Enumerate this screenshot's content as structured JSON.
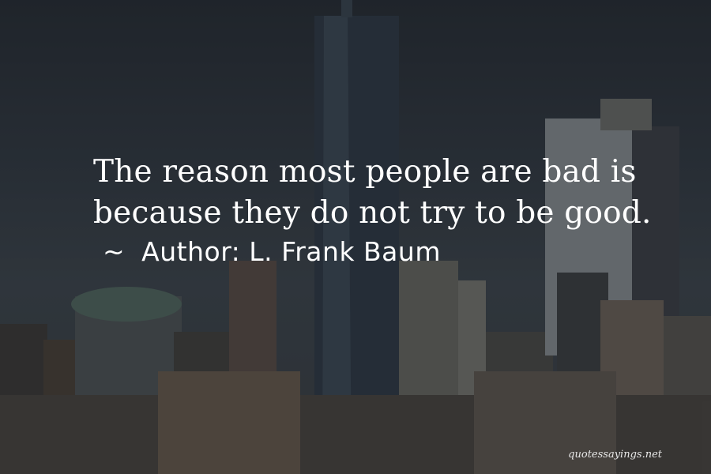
{
  "quote": {
    "lines": [
      "The reason most people are bad is",
      "because they do not try to be good."
    ]
  },
  "author": {
    "prefix": "~",
    "label": "Author:",
    "name": "L. Frank Baum"
  },
  "watermark": "quotessayings.net",
  "colors": {
    "text": "#ffffff",
    "overlay": "#1e242b"
  }
}
